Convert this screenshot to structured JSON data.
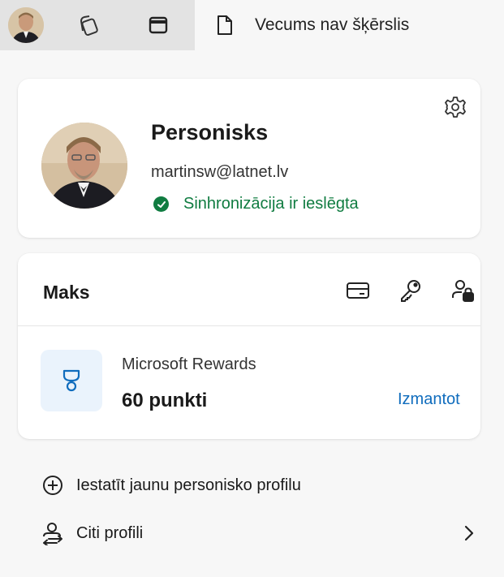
{
  "tabs": {
    "active_title": "Vecums nav šķērslis"
  },
  "profile": {
    "name": "Personisks",
    "email": "martinsw@latnet.lv",
    "sync_status": "Sinhronizācija ir ieslēgta"
  },
  "wallet": {
    "title": "Maks",
    "rewards_label": "Microsoft Rewards",
    "rewards_points": "60 punkti",
    "redeem_label": "Izmantot"
  },
  "menu": {
    "new_profile_label": "Iestatīt jaunu personisko profilu",
    "other_profiles_label": "Citi profili"
  },
  "colors": {
    "sync_green": "#107c41",
    "link_blue": "#0f6cbd",
    "rewards_tile": "#eaf3fc"
  },
  "icons": {
    "tab_avatar": "profile-avatar-icon",
    "collections": "collections-icon",
    "vertical_tabs": "vertical-tabs-icon",
    "page": "page-icon",
    "settings": "gear-icon",
    "sync": "check-circle-icon",
    "payment": "credit-card-icon",
    "passwords": "key-icon",
    "personal_info": "person-lock-icon",
    "rewards": "trophy-icon",
    "add": "add-circle-icon",
    "switch_profiles": "people-switch-icon",
    "chevron": "chevron-right-icon"
  }
}
